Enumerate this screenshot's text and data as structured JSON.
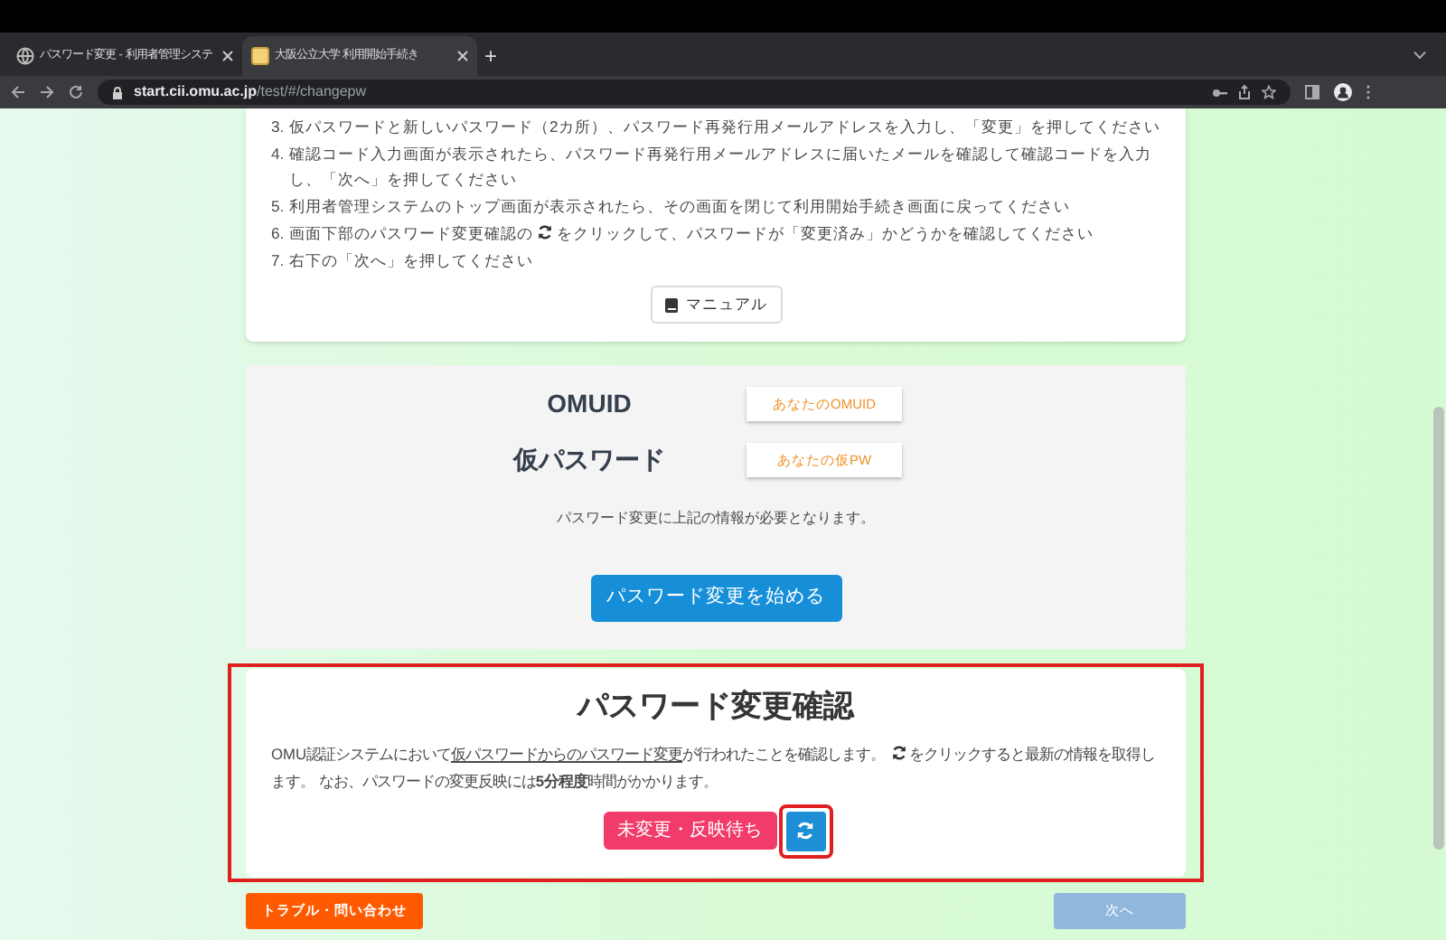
{
  "browser": {
    "tabs": [
      {
        "title": "パスワード変更 - 利用者管理システ",
        "selected": false,
        "kind": "globe"
      },
      {
        "title": "大阪公立大学 利用開始手続き",
        "selected": true,
        "kind": "favicon"
      }
    ],
    "new_tab": "+",
    "url": {
      "host": "start.cii.omu.ac.jp",
      "path": "/test/#/changepw"
    }
  },
  "steps": [
    {
      "number": "3.",
      "parts": [
        "仮パスワードと新しいパスワード（2カ所）、パスワード再発行用メールアドレスを入力し、「変更」を押してください"
      ]
    },
    {
      "number": "4.",
      "parts": [
        "確認コード入力画面が表示されたら、パスワード再発行用メールアドレスに届いたメールを確認して確認コードを入力し、「次へ」を押してください"
      ]
    },
    {
      "number": "5.",
      "parts": [
        "利用者管理システムのトップ画面が表示されたら、その画面を閉じて利用開始手続き画面に戻ってください"
      ]
    },
    {
      "number": "6.",
      "parts": [
        "画面下部のパスワード変更確認の",
        "をクリックして、パスワードが「変更済み」かどうかを確認してください"
      ]
    },
    {
      "number": "7.",
      "parts": [
        "右下の「次へ」を押してください"
      ]
    }
  ],
  "manual_button": "マニュアル",
  "credentials": [
    {
      "label": "OMUID",
      "value": "あなたのOMUID"
    },
    {
      "label": "仮パスワード",
      "value": "あなたの仮PW"
    }
  ],
  "credentials_note": "パスワード変更に上記の情報が必要となります。",
  "start_button": "パスワード変更を始める",
  "confirm": {
    "title": "パスワード変更確認",
    "highlighted": true,
    "text_before": "OMU認証システムにおいて",
    "link": "仮パスワードからのパスワード変更",
    "text_middle": "が行われたことを確認します。",
    "text_after": "をクリックすると最新の情報を取得します。 なお、パスワードの変更反映には**5分程度**時間がかかります。",
    "status": "未変更・反映待ち",
    "refresh_highlighted": true
  },
  "trouble_button": "トラブル・問い合わせ",
  "next_button": {
    "label": "次へ",
    "disabled": true
  }
}
